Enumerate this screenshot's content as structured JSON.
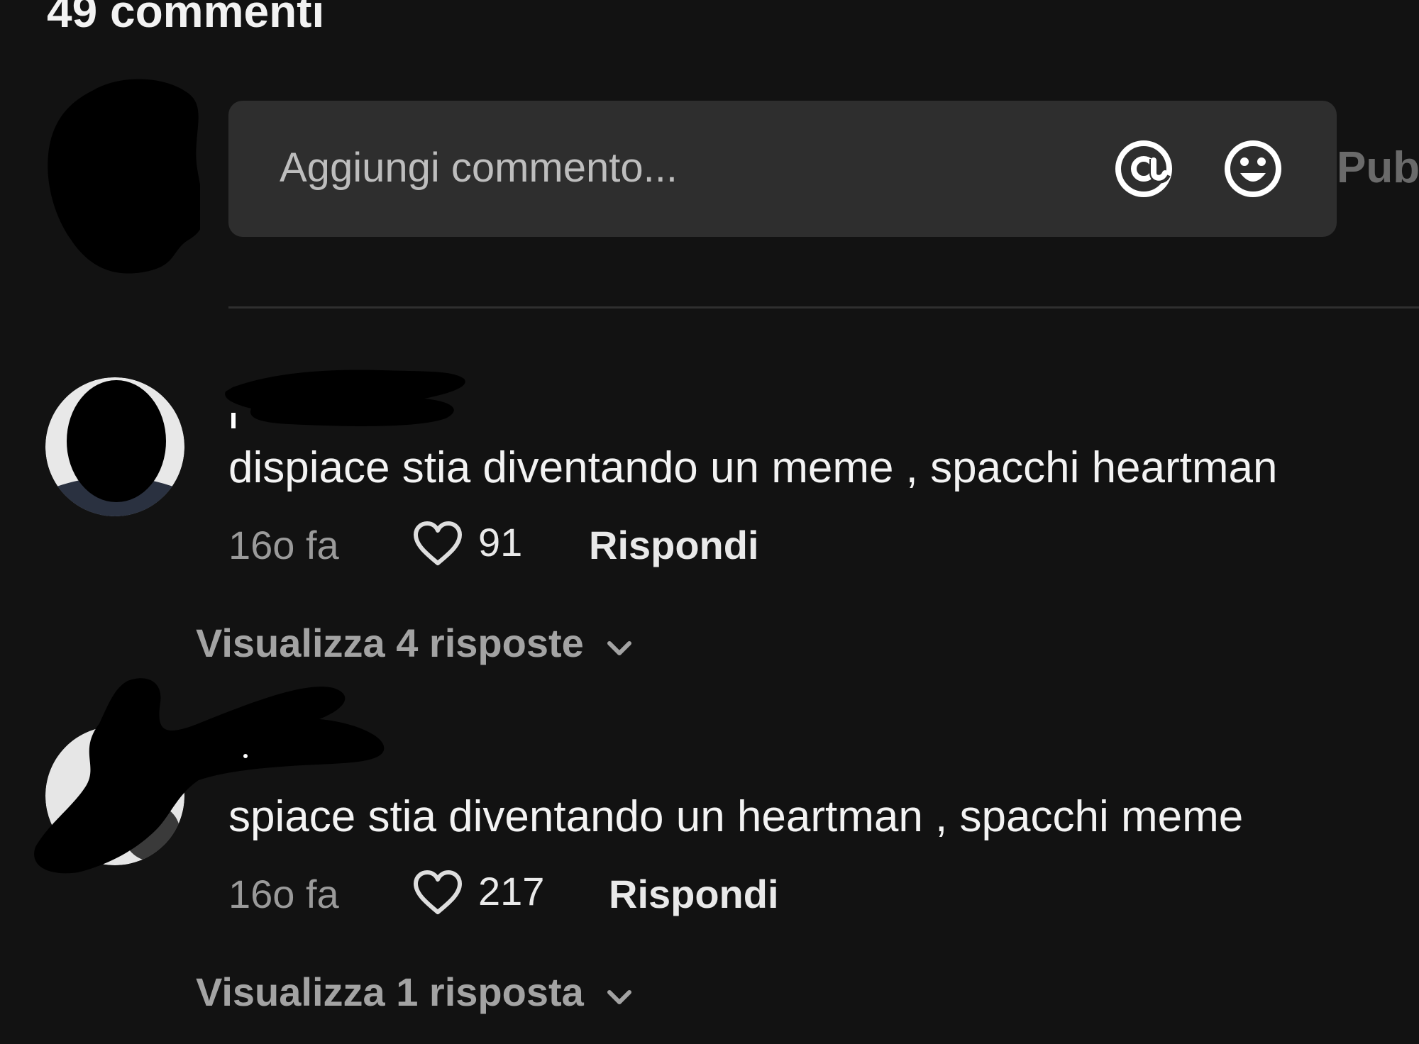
{
  "header": {
    "title": "49 commenti"
  },
  "composer": {
    "placeholder": "Aggiungi commento...",
    "mention_icon": "at-sign-icon",
    "emoji_icon": "smiley-icon",
    "publish_label": "Pub"
  },
  "comments": [
    {
      "text": "dispiace stia diventando un meme , spacchi heartman",
      "time": "16o fa",
      "likes": "91",
      "reply_label": "Rispondi",
      "view_replies": "Visualizza 4 risposte"
    },
    {
      "text": "spiace stia diventando un heartman , spacchi meme",
      "time": "16o fa",
      "likes": "217",
      "reply_label": "Rispondi",
      "view_replies": "Visualizza 1 risposta"
    }
  ],
  "colors": {
    "background": "#121212",
    "input_background": "#2e2e2e",
    "secondary_text": "#9a9a9a"
  }
}
